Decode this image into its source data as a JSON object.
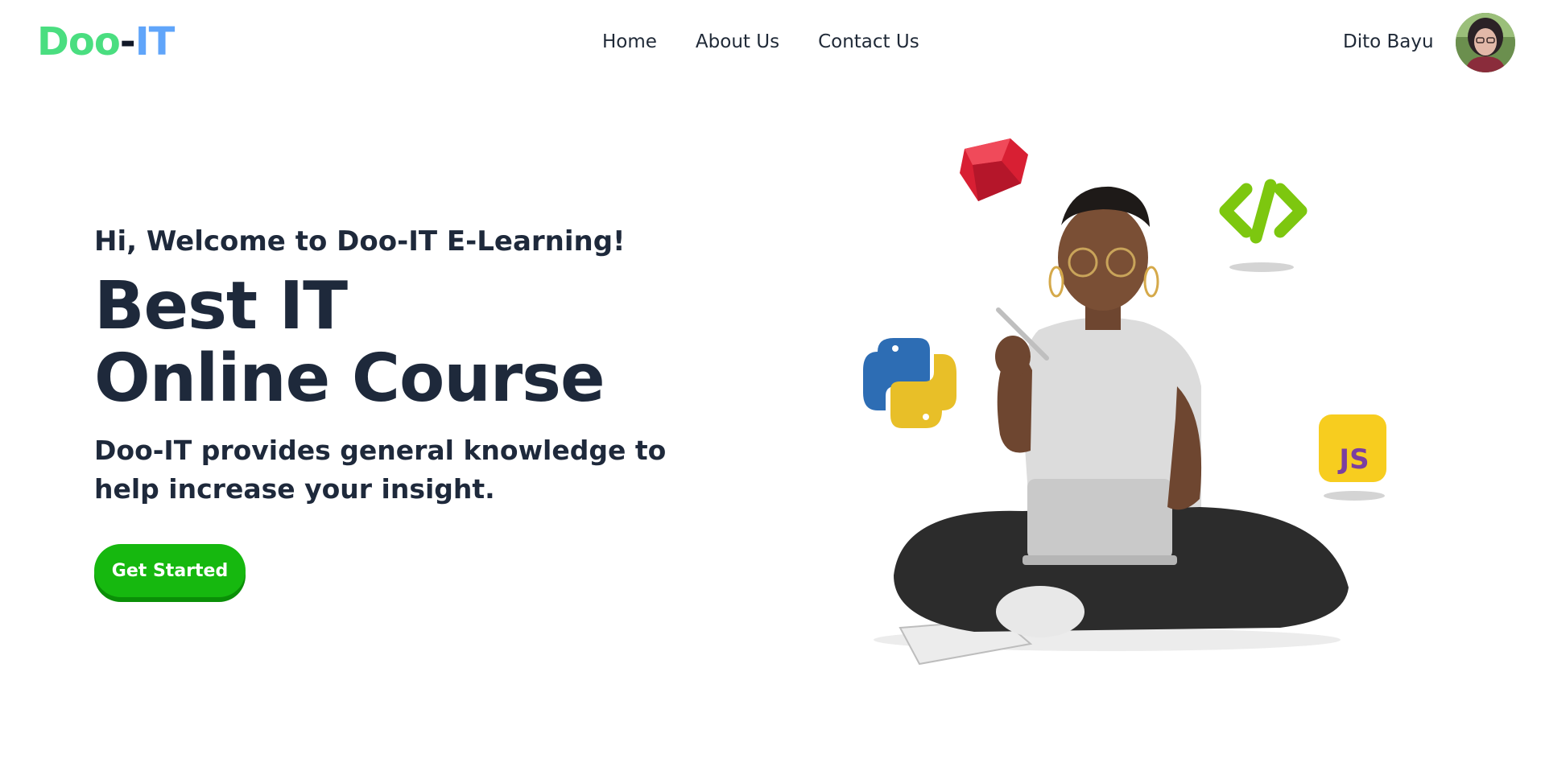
{
  "brand": {
    "logo_doo": "Doo",
    "logo_dash": "-",
    "logo_it": "IT"
  },
  "nav": {
    "items": [
      {
        "label": "Home"
      },
      {
        "label": "About Us"
      },
      {
        "label": "Contact Us"
      }
    ]
  },
  "user": {
    "name": "Dito Bayu",
    "avatar_icon": "user-avatar"
  },
  "hero": {
    "welcome": "Hi, Welcome to Doo-IT E-Learning!",
    "headline_line1": "Best IT",
    "headline_line2": "Online Course",
    "description": "Doo-IT provides general knowledge to help increase your insight.",
    "cta_label": "Get Started"
  },
  "illustration": {
    "icons": [
      "ruby-icon",
      "code-brackets-icon",
      "python-icon",
      "javascript-icon"
    ],
    "js_label": "JS"
  },
  "colors": {
    "brand_green": "#4ade80",
    "brand_blue": "#60a5fa",
    "cta_green": "#16b80f",
    "text_dark": "#1e293b"
  }
}
